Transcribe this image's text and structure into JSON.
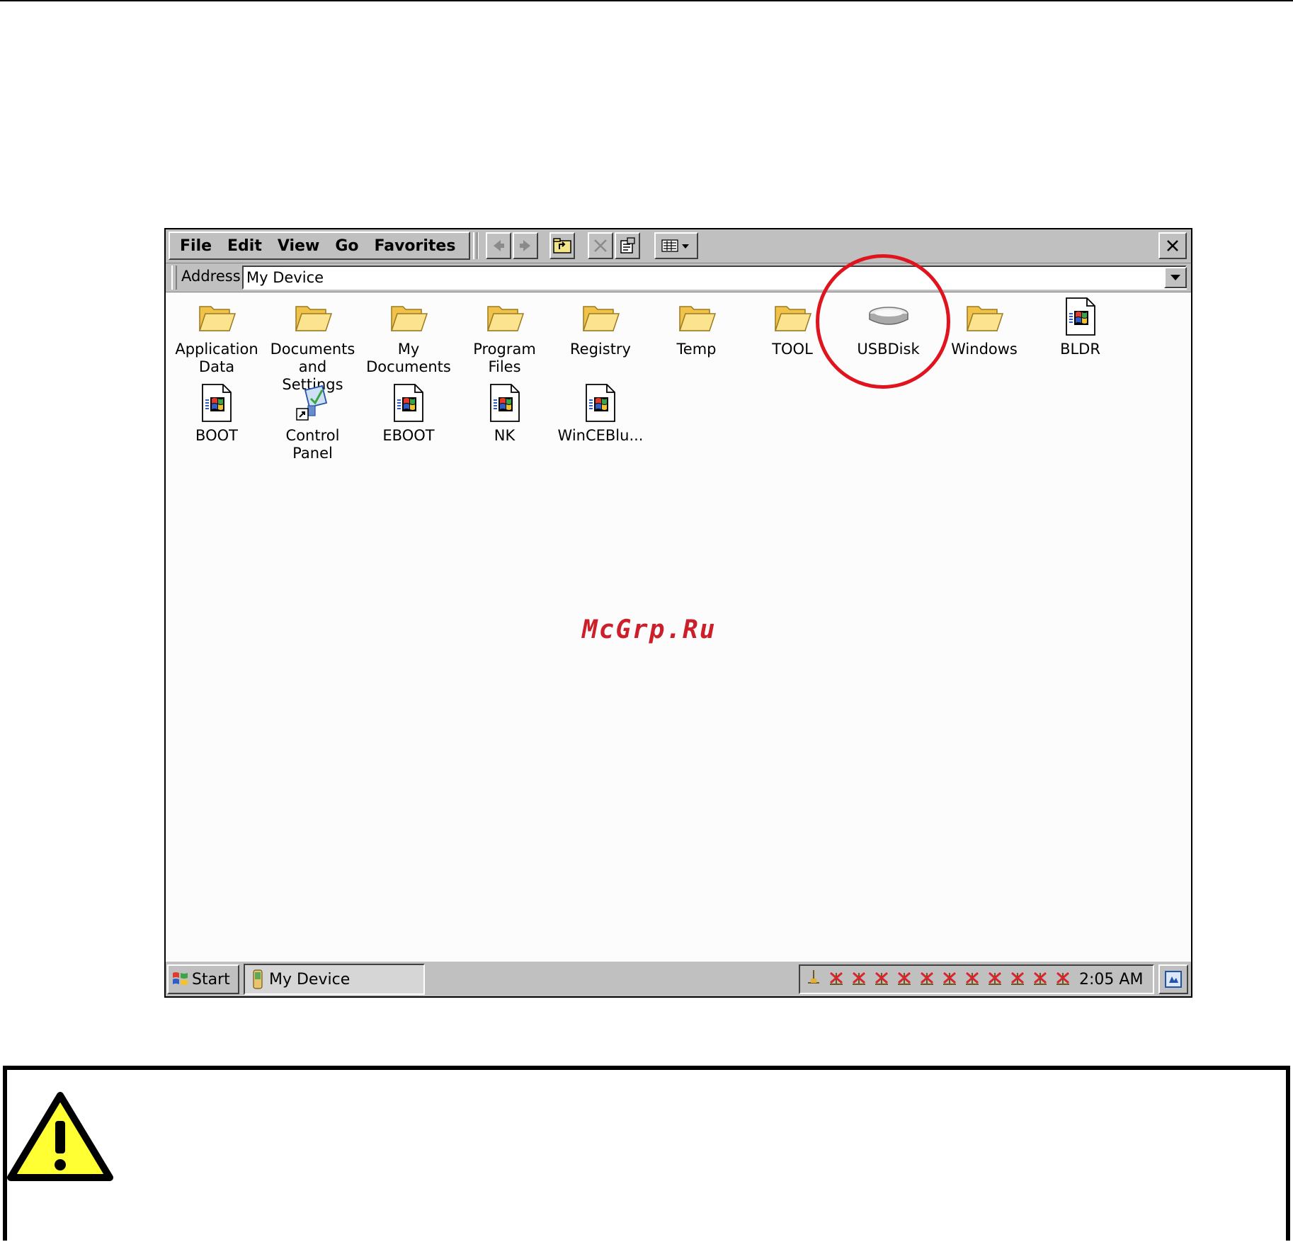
{
  "menu": {
    "file": "File",
    "edit": "Edit",
    "view": "View",
    "go": "Go",
    "favorites": "Favorites"
  },
  "toolbar": {
    "back_icon": "back-arrow-icon",
    "forward_icon": "forward-arrow-icon",
    "up_icon": "folder-up-icon",
    "delete_icon": "delete-icon",
    "properties_icon": "properties-icon",
    "views_icon": "views-icon",
    "close_icon": "close-icon"
  },
  "address": {
    "label": "Address",
    "value": "My Device"
  },
  "items": [
    {
      "label": "Application\nData",
      "icon": "folder-icon"
    },
    {
      "label": "Documents\nand Settings",
      "icon": "folder-icon"
    },
    {
      "label": "My\nDocuments",
      "icon": "folder-icon"
    },
    {
      "label": "Program Files",
      "icon": "folder-icon"
    },
    {
      "label": "Registry",
      "icon": "folder-icon"
    },
    {
      "label": "Temp",
      "icon": "folder-icon"
    },
    {
      "label": "TOOL",
      "icon": "folder-icon"
    },
    {
      "label": "USBDisk",
      "icon": "drive-icon"
    },
    {
      "label": "Windows",
      "icon": "folder-icon"
    },
    {
      "label": "BLDR",
      "icon": "file-icon"
    },
    {
      "label": "BOOT",
      "icon": "file-icon"
    },
    {
      "label": "Control\nPanel",
      "icon": "control-panel-icon"
    },
    {
      "label": "EBOOT",
      "icon": "file-icon"
    },
    {
      "label": "NK",
      "icon": "file-icon"
    },
    {
      "label": "WinCEBlu...",
      "icon": "file-icon"
    }
  ],
  "watermark": "McGrp.Ru",
  "taskbar": {
    "start_label": "Start",
    "task_label": "My Device",
    "clock": "2:05 AM"
  },
  "colors": {
    "highlight": "#e0141e",
    "folder": "#f5d76e",
    "warning": "#ffff33"
  }
}
